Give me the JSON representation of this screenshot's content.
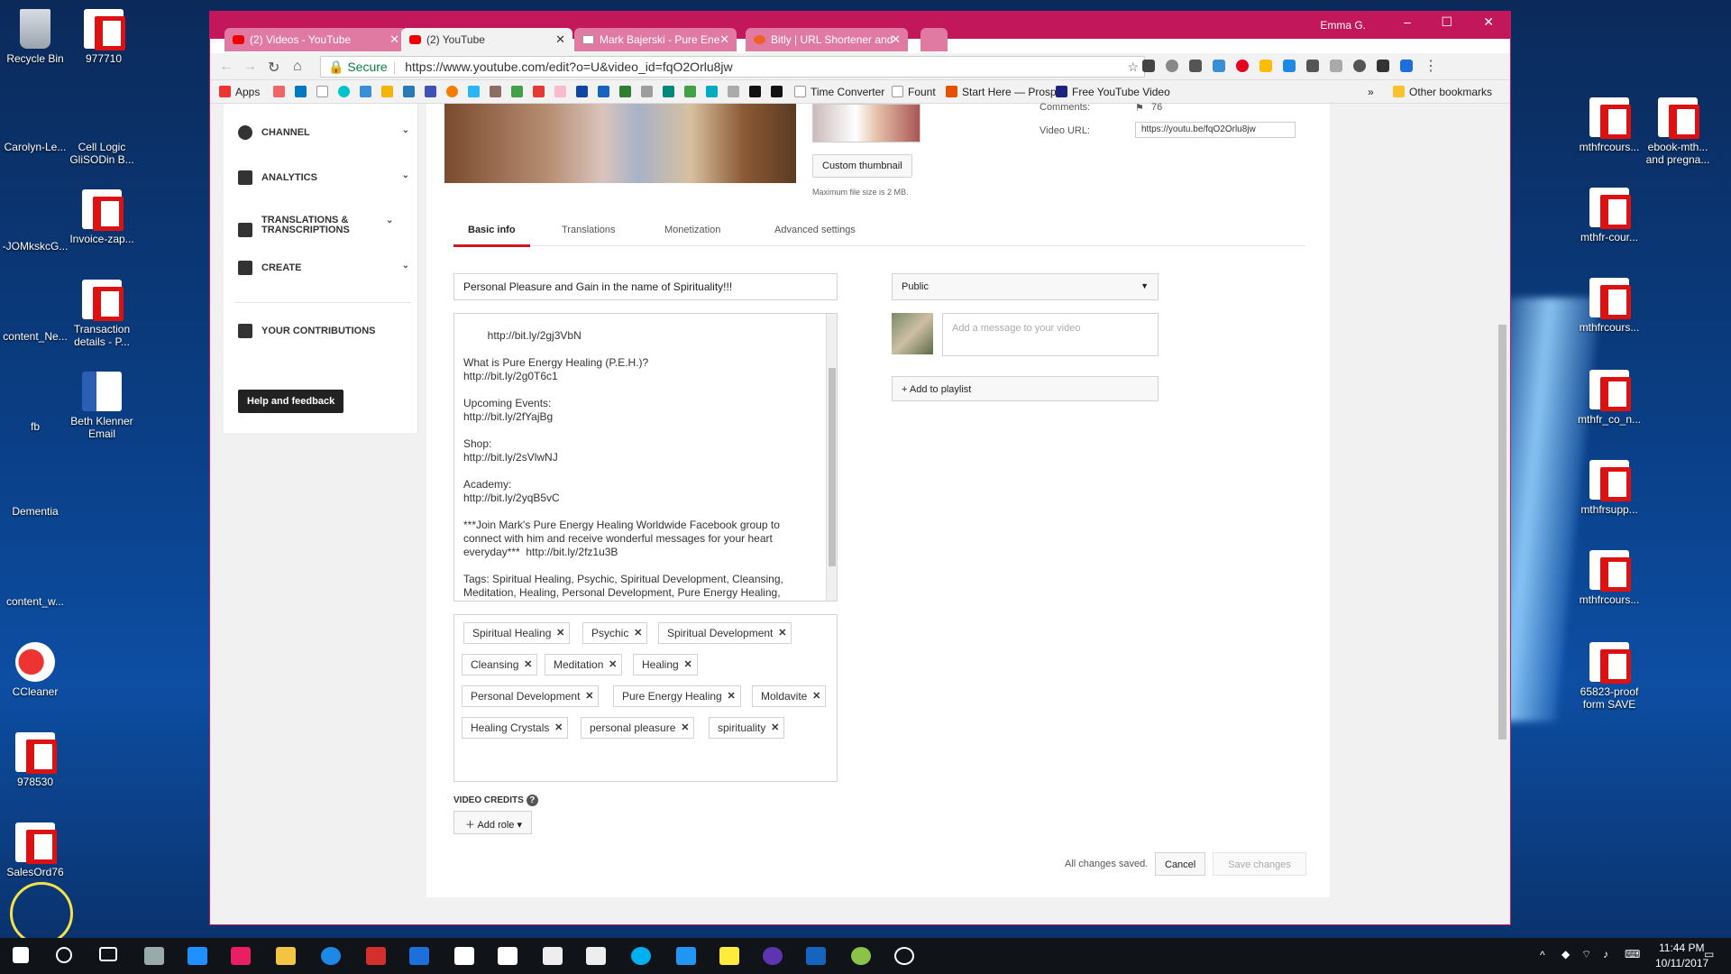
{
  "desktop": {
    "left_icons": [
      {
        "label": "Recycle Bin",
        "type": "bin"
      },
      {
        "label": "977710",
        "type": "pdf"
      },
      {
        "label": "Carolyn-Le...",
        "type": "photo"
      },
      {
        "label": "Cell Logic GliSODin B...",
        "type": "photo"
      },
      {
        "label": "-JOMkskcG...",
        "type": "photo"
      },
      {
        "label": "Invoice-zap...",
        "type": "pdf"
      },
      {
        "label": "content_Ne...",
        "type": "photo"
      },
      {
        "label": "Transaction details - P...",
        "type": "pdf"
      },
      {
        "label": "fb",
        "type": "photo"
      },
      {
        "label": "Beth Klenner Email",
        "type": "word"
      },
      {
        "label": "Dementia",
        "type": "photo"
      },
      {
        "label": "content_w...",
        "type": "photo"
      },
      {
        "label": "CCleaner",
        "type": "cc"
      },
      {
        "label": "978530",
        "type": "pdf"
      },
      {
        "label": "SalesOrd76",
        "type": "pdf"
      }
    ],
    "right_icons": [
      {
        "label": "mthfrcours...",
        "type": "pdf"
      },
      {
        "label": "ebook-mth... and pregna...",
        "type": "pdf"
      },
      {
        "label": "mthfr-cour...",
        "type": "pdf"
      },
      {
        "label": "mthfrcours...",
        "type": "pdf"
      },
      {
        "label": "mthfr_co_n...",
        "type": "pdf"
      },
      {
        "label": "mthfrsupp...",
        "type": "pdf"
      },
      {
        "label": "mthfrcours...",
        "type": "pdf"
      },
      {
        "label": "65823-proof form SAVE",
        "type": "pdf"
      }
    ]
  },
  "browser": {
    "user": "Emma G.",
    "window_controls": [
      "–",
      "☐",
      "✕"
    ],
    "tabs": [
      {
        "title": "(2) Videos - YouTube",
        "active": false,
        "favicon": "youtube"
      },
      {
        "title": "(2) YouTube",
        "active": true,
        "favicon": "youtube"
      },
      {
        "title": "Mark Bajerski - Pure Ene",
        "active": false,
        "favicon": "doc"
      },
      {
        "title": "Bitly | URL Shortener and",
        "active": false,
        "favicon": "bitly"
      }
    ],
    "secure_label": "Secure",
    "url": "https://www.youtube.com/edit?o=U&video_id=fqO2Orlu8jw",
    "bookmarks": [
      "Apps",
      "Time Converter",
      "Fount",
      "Start Here — Prospe",
      "Free YouTube Video",
      "Other bookmarks"
    ]
  },
  "sidebar": {
    "items": [
      {
        "label": "CHANNEL",
        "icon": "person-icon"
      },
      {
        "label": "ANALYTICS",
        "icon": "bar-chart-icon"
      },
      {
        "label": "TRANSLATIONS & TRANSCRIPTIONS",
        "icon": "translate-icon"
      },
      {
        "label": "CREATE",
        "icon": "video-camera-icon"
      }
    ],
    "contributions": "YOUR CONTRIBUTIONS",
    "help_button": "Help and feedback"
  },
  "video": {
    "custom_thumbnail": "Custom thumbnail",
    "max_file_note": "Maximum file size is 2 MB.",
    "comments_label": "Comments:",
    "comments_value": "76",
    "video_url_label": "Video URL:",
    "video_url": "https://youtu.be/fqO2Orlu8jw"
  },
  "edit_tabs": [
    "Basic info",
    "Translations",
    "Monetization",
    "Advanced settings"
  ],
  "form": {
    "title": "Personal Pleasure and Gain in the name of Spirituality!!!",
    "description": "http://bit.ly/2gj3VbN\n\nWhat is Pure Energy Healing (P.E.H.)?\nhttp://bit.ly/2g0T6c1\n\nUpcoming Events:\nhttp://bit.ly/2fYajBg\n\nShop:\nhttp://bit.ly/2sVlwNJ\n\nAcademy:\nhttp://bit.ly/2yqB5vC\n\n***Join Mark's Pure Energy Healing Worldwide Facebook group to connect with him and receive wonderful messages for your heart everyday***  http://bit.ly/2fz1u3B\n\nTags: Spiritual Healing, Psychic, Spiritual Development, Cleansing, Meditation, Healing, Personal Development, Pure Energy Healing, Moldavite, Healing Crystals,",
    "tags": [
      "Spiritual Healing",
      "Psychic",
      "Spiritual Development",
      "Cleansing",
      "Meditation",
      "Healing",
      "Personal Development",
      "Pure Energy Healing",
      "Moldavite",
      "Healing Crystals",
      "personal pleasure",
      "spirituality"
    ],
    "video_credits": "VIDEO CREDITS",
    "add_role": "Add role",
    "privacy": "Public",
    "message_placeholder": "Add a message to your video",
    "add_playlist": "+ Add to playlist",
    "saved_status": "All changes saved.",
    "cancel": "Cancel",
    "save": "Save changes"
  },
  "taskbar": {
    "time": "11:44 PM",
    "date": "10/11/2017"
  }
}
